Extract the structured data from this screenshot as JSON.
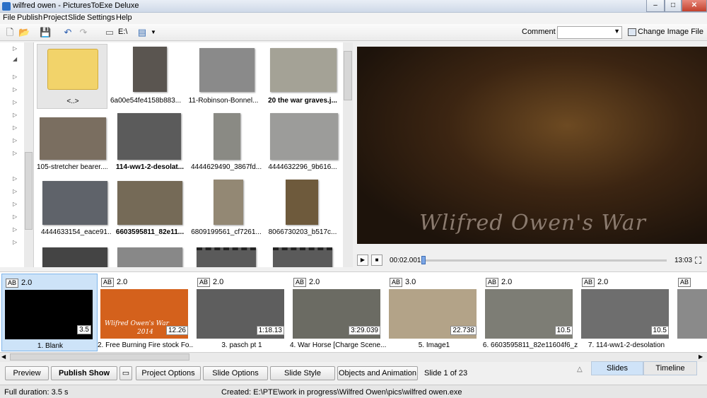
{
  "window": {
    "title": "wilfred owen - PicturesToExe Deluxe",
    "min": "–",
    "max": "□",
    "close": "✕"
  },
  "menu": [
    "File",
    "Publish",
    "Project",
    "Slide",
    "Settings",
    "Help"
  ],
  "toolbar": {
    "drive": "E:\\",
    "comment_label": "Comment",
    "comment_value": "",
    "change_image": "Change Image File"
  },
  "files": [
    {
      "caption": "<..>",
      "bold": false
    },
    {
      "caption": "6a00e54fe4158b883...",
      "bold": false
    },
    {
      "caption": "11-Robinson-Bonnel...",
      "bold": false
    },
    {
      "caption": "20 the war graves.j...",
      "bold": true
    },
    {
      "caption": "105-stretcher bearer....",
      "bold": false
    },
    {
      "caption": "114-ww1-2-desolat...",
      "bold": true
    },
    {
      "caption": "4444629490_3867fd...",
      "bold": false
    },
    {
      "caption": "4444632296_9b616...",
      "bold": false
    },
    {
      "caption": "4444633154_eace91...",
      "bold": false
    },
    {
      "caption": "6603595811_82e11...",
      "bold": true
    },
    {
      "caption": "6809199561_cf7261...",
      "bold": false
    },
    {
      "caption": "8066730203_b517c...",
      "bold": false
    },
    {
      "caption": "",
      "bold": false
    },
    {
      "caption": "",
      "bold": false
    },
    {
      "caption": "",
      "bold": false
    },
    {
      "caption": "",
      "bold": false
    }
  ],
  "preview": {
    "title": "Wlifred Owen's War"
  },
  "player": {
    "play": "▶",
    "stop": "■",
    "position": "00:02.001",
    "duration": "13:03",
    "progress": 0.0
  },
  "slides": [
    {
      "ab": "AB",
      "duration": "2.0",
      "badge": "3.5",
      "name": "1. Blank",
      "color": "#000000",
      "selected": true
    },
    {
      "ab": "AB",
      "duration": "2.0",
      "badge": "12.26",
      "name": "2. Free Burning Fire stock Fo...",
      "color": "#d4611c",
      "overlay": "Wlifred Owen's War",
      "overlay2": "2014"
    },
    {
      "ab": "AB",
      "duration": "2.0",
      "badge": "1:18.13",
      "name": "3. pasch pt 1",
      "color": "#5e5e5e"
    },
    {
      "ab": "AB",
      "duration": "2.0",
      "badge": "3:29.039",
      "name": "4. War Horse [Charge Scene...",
      "color": "#6b6b63"
    },
    {
      "ab": "AB",
      "duration": "3.0",
      "badge": "22.738",
      "name": "5. Image1",
      "color": "#b3a388"
    },
    {
      "ab": "AB",
      "duration": "2.0",
      "badge": "10.5",
      "name": "6. 6603595811_82e11604f6_z",
      "color": "#7d7d75"
    },
    {
      "ab": "AB",
      "duration": "2.0",
      "badge": "10.5",
      "name": "7. 114-ww1-2-desolation",
      "color": "#6e6e6e"
    },
    {
      "ab": "AB",
      "duration": "",
      "badge": "",
      "name": "8. C",
      "color": "#8a8a8a"
    }
  ],
  "buttons": {
    "preview": "Preview",
    "publish": "Publish Show",
    "project_options": "Project Options",
    "slide_options": "Slide Options",
    "slide_style": "Slide Style",
    "objects": "Objects and Animation"
  },
  "slide_count": "Slide 1 of 23",
  "tabs": {
    "slides": "Slides",
    "timeline": "Timeline"
  },
  "status": {
    "full_duration": "Full duration: 3.5 s",
    "created": "Created: E:\\PTE\\work in progress\\Wilfred Owen\\pics\\wilfred owen.exe"
  }
}
